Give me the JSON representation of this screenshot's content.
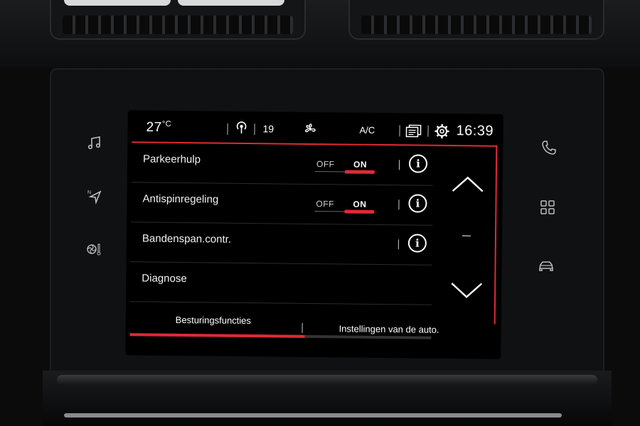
{
  "status_bar": {
    "temperature": "27",
    "temp_unit": "°C",
    "radio_station": "19",
    "ac_label": "A/C",
    "clock": "16:39"
  },
  "menu": {
    "rows": [
      {
        "label": "Parkeerhulp",
        "toggle": {
          "off_label": "OFF",
          "on_label": "ON",
          "state": "ON"
        },
        "has_info": true
      },
      {
        "label": "Antispinregeling",
        "toggle": {
          "off_label": "OFF",
          "on_label": "ON",
          "state": "ON"
        },
        "has_info": true
      },
      {
        "label": "Bandenspan.contr.",
        "has_info": true
      },
      {
        "label": "Diagnose",
        "has_info": false
      }
    ],
    "scroll_progress": 0.58
  },
  "tabs": [
    {
      "label": "Besturingsfuncties",
      "active": true
    },
    {
      "label": "Instellingen van de auto.",
      "active": false
    }
  ],
  "side_buttons_left": [
    "music-icon",
    "navigation-icon",
    "climate-icon"
  ],
  "side_buttons_right": [
    "phone-icon",
    "apps-grid-icon",
    "car-icon"
  ],
  "colors": {
    "accent": "#e02a32",
    "screen_bg": "#000000"
  },
  "info_glyph": "i"
}
